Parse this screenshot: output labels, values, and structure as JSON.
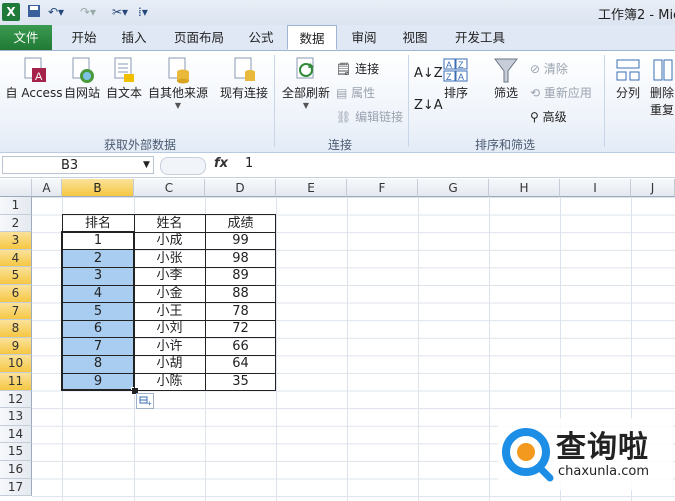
{
  "window": {
    "title": "工作簿2 - Mic"
  },
  "tabs": [
    {
      "label": "文件"
    },
    {
      "label": "开始"
    },
    {
      "label": "插入"
    },
    {
      "label": "页面布局"
    },
    {
      "label": "公式"
    },
    {
      "label": "数据"
    },
    {
      "label": "审阅"
    },
    {
      "label": "视图"
    },
    {
      "label": "开发工具"
    }
  ],
  "ribbon": {
    "get_external": {
      "access": "自 Access",
      "web": "自网站",
      "text": "自文本",
      "other": "自其他来源",
      "existing": "现有连接",
      "group_label": "获取外部数据"
    },
    "connections": {
      "refresh_all": "全部刷新",
      "connections": "连接",
      "properties": "属性",
      "edit_links": "编辑链接",
      "group_label": "连接"
    },
    "sort_filter": {
      "sort": "排序",
      "filter": "筛选",
      "clear": "清除",
      "reapply": "重新应用",
      "advanced": "高级",
      "group_label": "排序和筛选"
    },
    "tools": {
      "split": "分列",
      "remove": "删除",
      "remove2": "重复"
    }
  },
  "formula_bar": {
    "name_box": "B3",
    "fx": "fx",
    "value": "1"
  },
  "columns": [
    "A",
    "B",
    "C",
    "D",
    "E",
    "F",
    "G",
    "H",
    "I",
    "J"
  ],
  "rows": [
    "1",
    "2",
    "3",
    "4",
    "5",
    "6",
    "7",
    "8",
    "9",
    "10",
    "11",
    "12",
    "13",
    "14",
    "15",
    "16",
    "17"
  ],
  "sheet": {
    "headers": [
      "排名",
      "姓名",
      "成绩"
    ],
    "data": [
      [
        "1",
        "小成",
        "99"
      ],
      [
        "2",
        "小张",
        "98"
      ],
      [
        "3",
        "小李",
        "89"
      ],
      [
        "4",
        "小金",
        "88"
      ],
      [
        "5",
        "小王",
        "78"
      ],
      [
        "6",
        "小刘",
        "72"
      ],
      [
        "7",
        "小许",
        "66"
      ],
      [
        "8",
        "小胡",
        "64"
      ],
      [
        "9",
        "小陈",
        "35"
      ]
    ]
  },
  "watermark": {
    "brand": "查询啦",
    "url": "chaxunla.com"
  },
  "colors": {
    "selection": "#a9cdf0",
    "file_tab": "#207a35",
    "header_sel": "#f5c743"
  }
}
